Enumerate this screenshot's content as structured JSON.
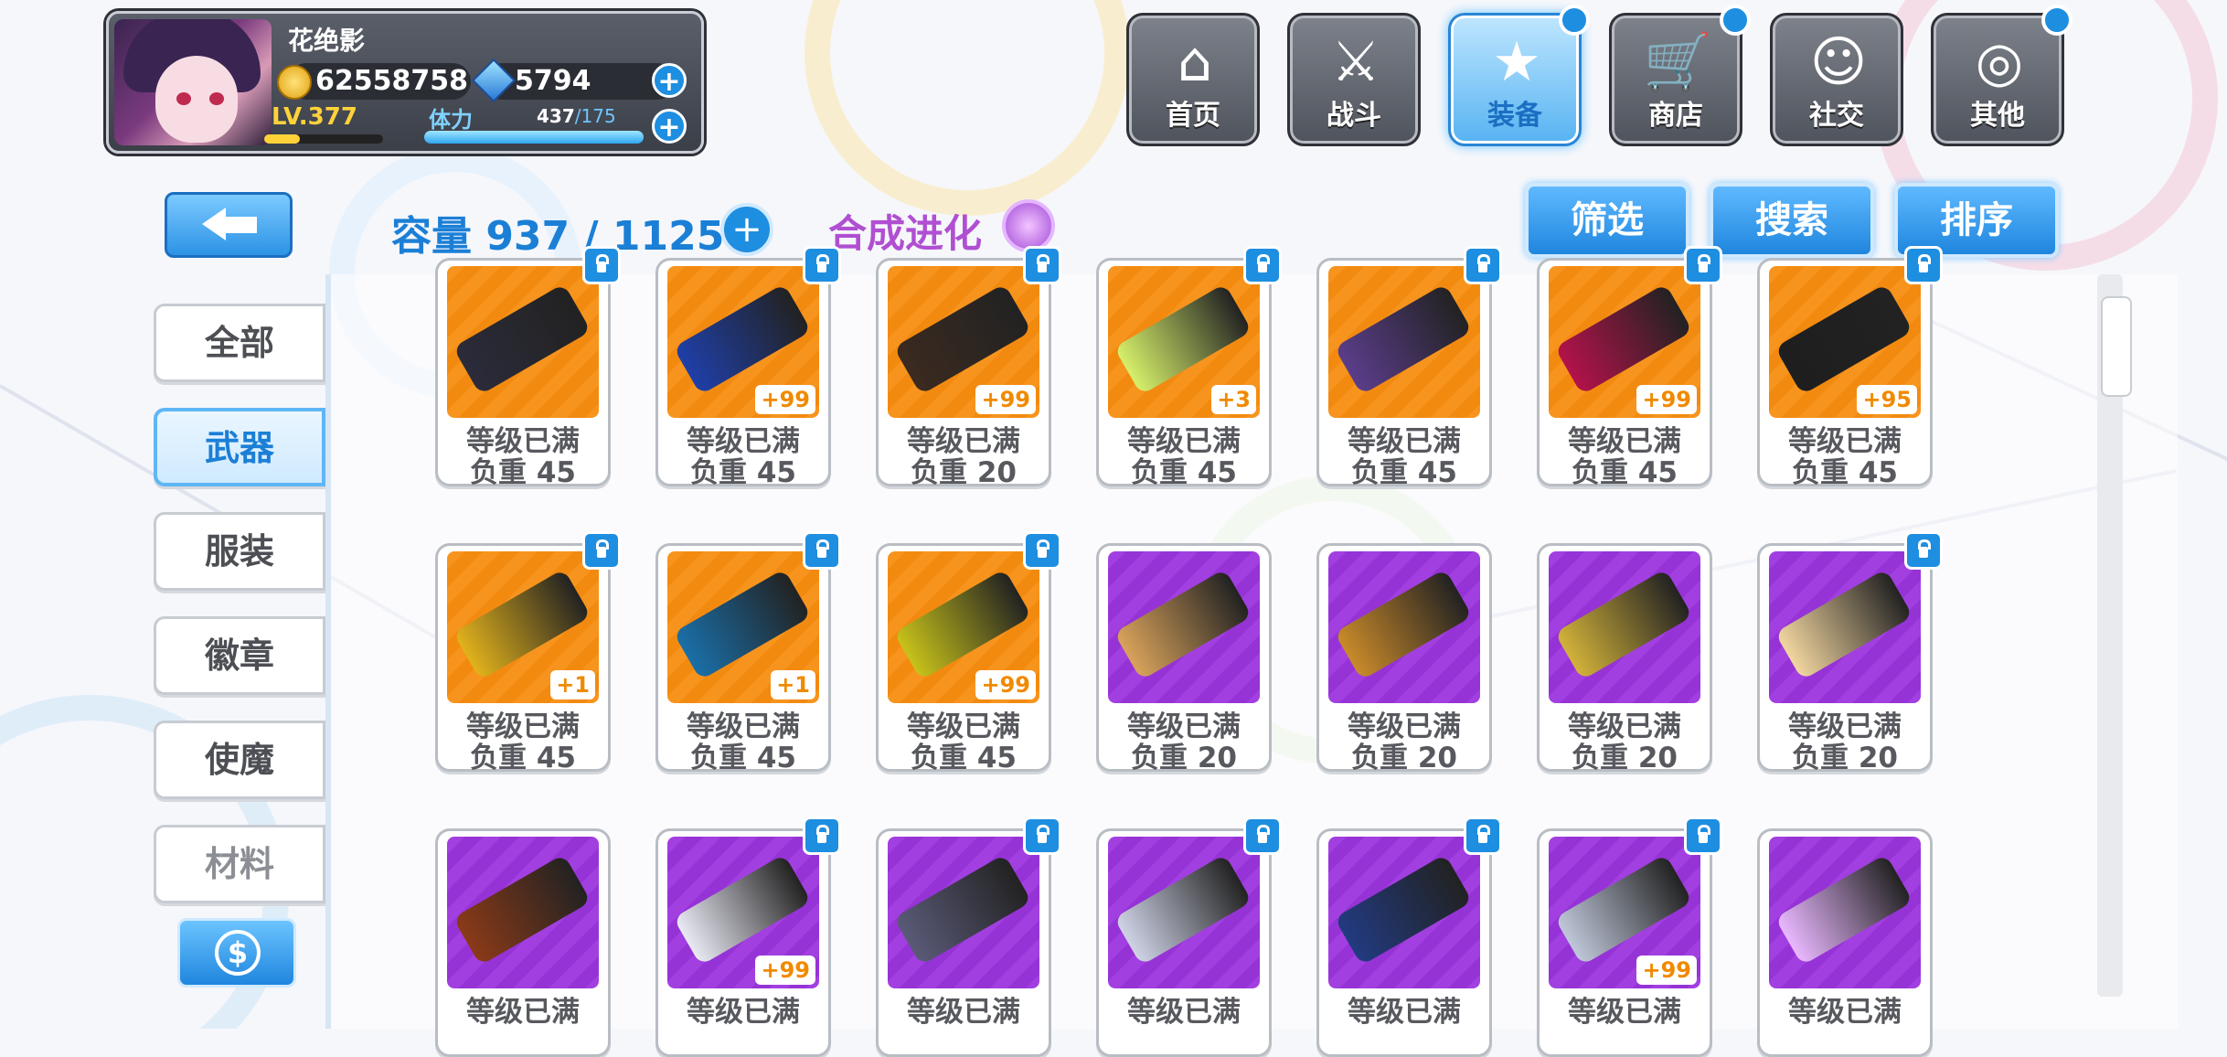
{
  "player": {
    "name": "花绝影",
    "gold": "62558758",
    "gems": "5794",
    "level": "LV.377",
    "stamina_label": "体力",
    "stamina_current": "437",
    "stamina_max": "/175"
  },
  "nav": [
    {
      "label": "首页",
      "icon": "house-icon",
      "glyph": "⌂",
      "active": false,
      "dot": false
    },
    {
      "label": "战斗",
      "icon": "crossed-guns-icon",
      "glyph": "⚔",
      "active": false,
      "dot": false
    },
    {
      "label": "装备",
      "icon": "star-gun-icon",
      "glyph": "★",
      "active": true,
      "dot": true
    },
    {
      "label": "商店",
      "icon": "cart-icon",
      "glyph": "🛒",
      "active": false,
      "dot": true
    },
    {
      "label": "社交",
      "icon": "friend-icon",
      "glyph": "☺",
      "active": false,
      "dot": false
    },
    {
      "label": "其他",
      "icon": "settings-icon",
      "glyph": "◎",
      "active": false,
      "dot": true
    }
  ],
  "inventory": {
    "capacity_text": "容量 937 / 1125",
    "evolve_label": "合成进化",
    "filter_label": "筛选",
    "search_label": "搜索",
    "sort_label": "排序"
  },
  "categories": [
    {
      "label": "全部",
      "active": false
    },
    {
      "label": "武器",
      "active": true
    },
    {
      "label": "服装",
      "active": false
    },
    {
      "label": "徽章",
      "active": false
    },
    {
      "label": "使魔",
      "active": false
    },
    {
      "label": "材料",
      "active": false
    }
  ],
  "items": [
    {
      "color": "orange",
      "plus": "",
      "status": "等级已满",
      "weight": "负重 45",
      "lock": true
    },
    {
      "color": "orange",
      "plus": "+99",
      "status": "等级已满",
      "weight": "负重 45",
      "lock": true
    },
    {
      "color": "orange",
      "plus": "+99",
      "status": "等级已满",
      "weight": "负重 20",
      "lock": true
    },
    {
      "color": "orange",
      "plus": "+3",
      "status": "等级已满",
      "weight": "负重 45",
      "lock": true
    },
    {
      "color": "orange",
      "plus": "",
      "status": "等级已满",
      "weight": "负重 45",
      "lock": true
    },
    {
      "color": "orange",
      "plus": "+99",
      "status": "等级已满",
      "weight": "负重 45",
      "lock": true
    },
    {
      "color": "orange",
      "plus": "+95",
      "status": "等级已满",
      "weight": "负重 45",
      "lock": true
    },
    {
      "color": "orange",
      "plus": "+1",
      "status": "等级已满",
      "weight": "负重 45",
      "lock": true
    },
    {
      "color": "orange",
      "plus": "+1",
      "status": "等级已满",
      "weight": "负重 45",
      "lock": true
    },
    {
      "color": "orange",
      "plus": "+99",
      "status": "等级已满",
      "weight": "负重 45",
      "lock": true
    },
    {
      "color": "purple",
      "plus": "",
      "status": "等级已满",
      "weight": "负重 20",
      "lock": false
    },
    {
      "color": "purple",
      "plus": "",
      "status": "等级已满",
      "weight": "负重 20",
      "lock": false
    },
    {
      "color": "purple",
      "plus": "",
      "status": "等级已满",
      "weight": "负重 20",
      "lock": false
    },
    {
      "color": "purple",
      "plus": "",
      "status": "等级已满",
      "weight": "负重 20",
      "lock": true
    },
    {
      "color": "purple",
      "plus": "",
      "status": "等级已满",
      "weight": "",
      "lock": false
    },
    {
      "color": "purple",
      "plus": "+99",
      "status": "等级已满",
      "weight": "",
      "lock": true
    },
    {
      "color": "purple",
      "plus": "",
      "status": "等级已满",
      "weight": "",
      "lock": true
    },
    {
      "color": "purple",
      "plus": "",
      "status": "等级已满",
      "weight": "",
      "lock": true
    },
    {
      "color": "purple",
      "plus": "",
      "status": "等级已满",
      "weight": "",
      "lock": true
    },
    {
      "color": "purple",
      "plus": "+99",
      "status": "等级已满",
      "weight": "",
      "lock": true
    },
    {
      "color": "purple",
      "plus": "",
      "status": "等级已满",
      "weight": "",
      "lock": false
    }
  ],
  "icons": {
    "coin": "gold-coin-icon",
    "gem": "blue-gem-icon",
    "back": "back-arrow-icon",
    "evolve": "evolve-swirl-icon",
    "currency_button": "dollar-icon",
    "lock": "lock-icon"
  },
  "colors": {
    "accent": "#1e8ee0",
    "evolve": "#b04fd2",
    "orange_rarity": "#f7941d",
    "purple_rarity": "#a23fe0"
  }
}
